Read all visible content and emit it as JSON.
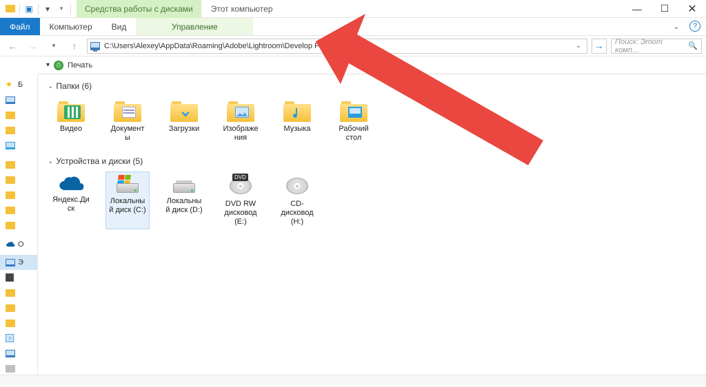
{
  "titlebar": {
    "ctx_label": "Средства работы с дисками",
    "window_title": "Этот компьютер"
  },
  "ribbon": {
    "file": "Файл",
    "computer": "Компьютер",
    "view": "Вид",
    "manage": "Управление"
  },
  "address": {
    "path": "C:\\Users\\Alexey\\AppData\\Roaming\\Adobe\\Lightroom\\Develop Presets"
  },
  "search": {
    "placeholder": "Поиск: Этот комп…"
  },
  "toolbar": {
    "print": "Печать"
  },
  "groups": {
    "folders_header": "Папки (6)",
    "devices_header": "Устройства и диски (5)"
  },
  "folders": [
    {
      "label": "Видео",
      "overlay": "film"
    },
    {
      "label": "Документы",
      "overlay": "doc"
    },
    {
      "label": "Загрузки",
      "overlay": "download"
    },
    {
      "label": "Изображения",
      "overlay": "image"
    },
    {
      "label": "Музыка",
      "overlay": "music"
    },
    {
      "label": "Рабочий стол",
      "overlay": "desktop"
    }
  ],
  "drives": [
    {
      "label": "Яндекс.Диск",
      "kind": "onedrive"
    },
    {
      "label": "Локальный диск (C:)",
      "kind": "drive-win",
      "selected": true
    },
    {
      "label": "Локальный диск (D:)",
      "kind": "drive"
    },
    {
      "label": "DVD RW дисковод (E:)",
      "kind": "dvd"
    },
    {
      "label": "CD-дисковод (H:)",
      "kind": "cd"
    }
  ],
  "sidebar": {
    "quick_access": "Б",
    "onedrive": "O",
    "this_pc": "Э"
  }
}
